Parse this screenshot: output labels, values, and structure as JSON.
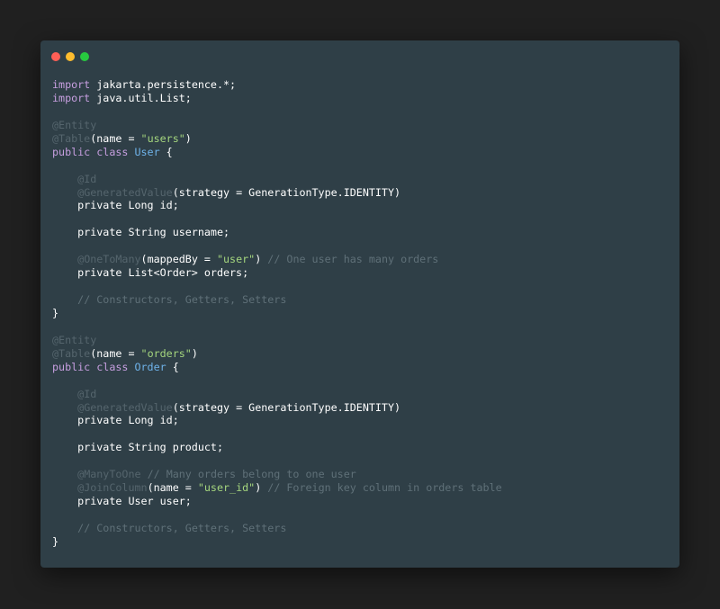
{
  "window": {
    "controls": [
      "close",
      "minimize",
      "maximize"
    ]
  },
  "colors": {
    "background": "#202020",
    "editor": "#2f3f47",
    "keyword": "#c79fe0",
    "annotation": "#55656d",
    "string": "#a5d67e",
    "class_name": "#6fb3ea",
    "comment": "#5f7078",
    "text": "#ffffff"
  },
  "code": {
    "language": "java",
    "lines": [
      [
        [
          "kw",
          "import"
        ],
        [
          "plain",
          " jakarta.persistence.*;"
        ]
      ],
      [
        [
          "kw",
          "import"
        ],
        [
          "plain",
          " java.util.List;"
        ]
      ],
      [],
      [
        [
          "ann",
          "@Entity"
        ]
      ],
      [
        [
          "ann",
          "@Table"
        ],
        [
          "plain",
          "(name = "
        ],
        [
          "str",
          "\"users\""
        ],
        [
          "plain",
          ")"
        ]
      ],
      [
        [
          "kw",
          "public class "
        ],
        [
          "cls",
          "User"
        ],
        [
          "plain",
          " {"
        ]
      ],
      [],
      [
        [
          "plain",
          "    "
        ],
        [
          "ann",
          "@Id"
        ]
      ],
      [
        [
          "plain",
          "    "
        ],
        [
          "ann",
          "@GeneratedValue"
        ],
        [
          "plain",
          "(strategy = GenerationType.IDENTITY)"
        ]
      ],
      [
        [
          "plain",
          "    private Long id;"
        ]
      ],
      [],
      [
        [
          "plain",
          "    private String username;"
        ]
      ],
      [],
      [
        [
          "plain",
          "    "
        ],
        [
          "ann",
          "@OneToMany"
        ],
        [
          "plain",
          "(mappedBy = "
        ],
        [
          "str",
          "\"user\""
        ],
        [
          "plain",
          ") "
        ],
        [
          "cmt",
          "// One user has many orders"
        ]
      ],
      [
        [
          "plain",
          "    private List<Order> orders;"
        ]
      ],
      [],
      [
        [
          "plain",
          "    "
        ],
        [
          "cmt",
          "// Constructors, Getters, Setters"
        ]
      ],
      [
        [
          "plain",
          "}"
        ]
      ],
      [],
      [
        [
          "ann",
          "@Entity"
        ]
      ],
      [
        [
          "ann",
          "@Table"
        ],
        [
          "plain",
          "(name = "
        ],
        [
          "str",
          "\"orders\""
        ],
        [
          "plain",
          ")"
        ]
      ],
      [
        [
          "kw",
          "public class "
        ],
        [
          "cls",
          "Order"
        ],
        [
          "plain",
          " {"
        ]
      ],
      [],
      [
        [
          "plain",
          "    "
        ],
        [
          "ann",
          "@Id"
        ]
      ],
      [
        [
          "plain",
          "    "
        ],
        [
          "ann",
          "@GeneratedValue"
        ],
        [
          "plain",
          "(strategy = GenerationType.IDENTITY)"
        ]
      ],
      [
        [
          "plain",
          "    private Long id;"
        ]
      ],
      [],
      [
        [
          "plain",
          "    private String product;"
        ]
      ],
      [],
      [
        [
          "plain",
          "    "
        ],
        [
          "ann",
          "@ManyToOne"
        ],
        [
          "plain",
          " "
        ],
        [
          "cmt",
          "// Many orders belong to one user"
        ]
      ],
      [
        [
          "plain",
          "    "
        ],
        [
          "ann",
          "@JoinColumn"
        ],
        [
          "plain",
          "(name = "
        ],
        [
          "str",
          "\"user_id\""
        ],
        [
          "plain",
          ") "
        ],
        [
          "cmt",
          "// Foreign key column in orders table"
        ]
      ],
      [
        [
          "plain",
          "    private User user;"
        ]
      ],
      [],
      [
        [
          "plain",
          "    "
        ],
        [
          "cmt",
          "// Constructors, Getters, Setters"
        ]
      ],
      [
        [
          "plain",
          "}"
        ]
      ]
    ]
  }
}
